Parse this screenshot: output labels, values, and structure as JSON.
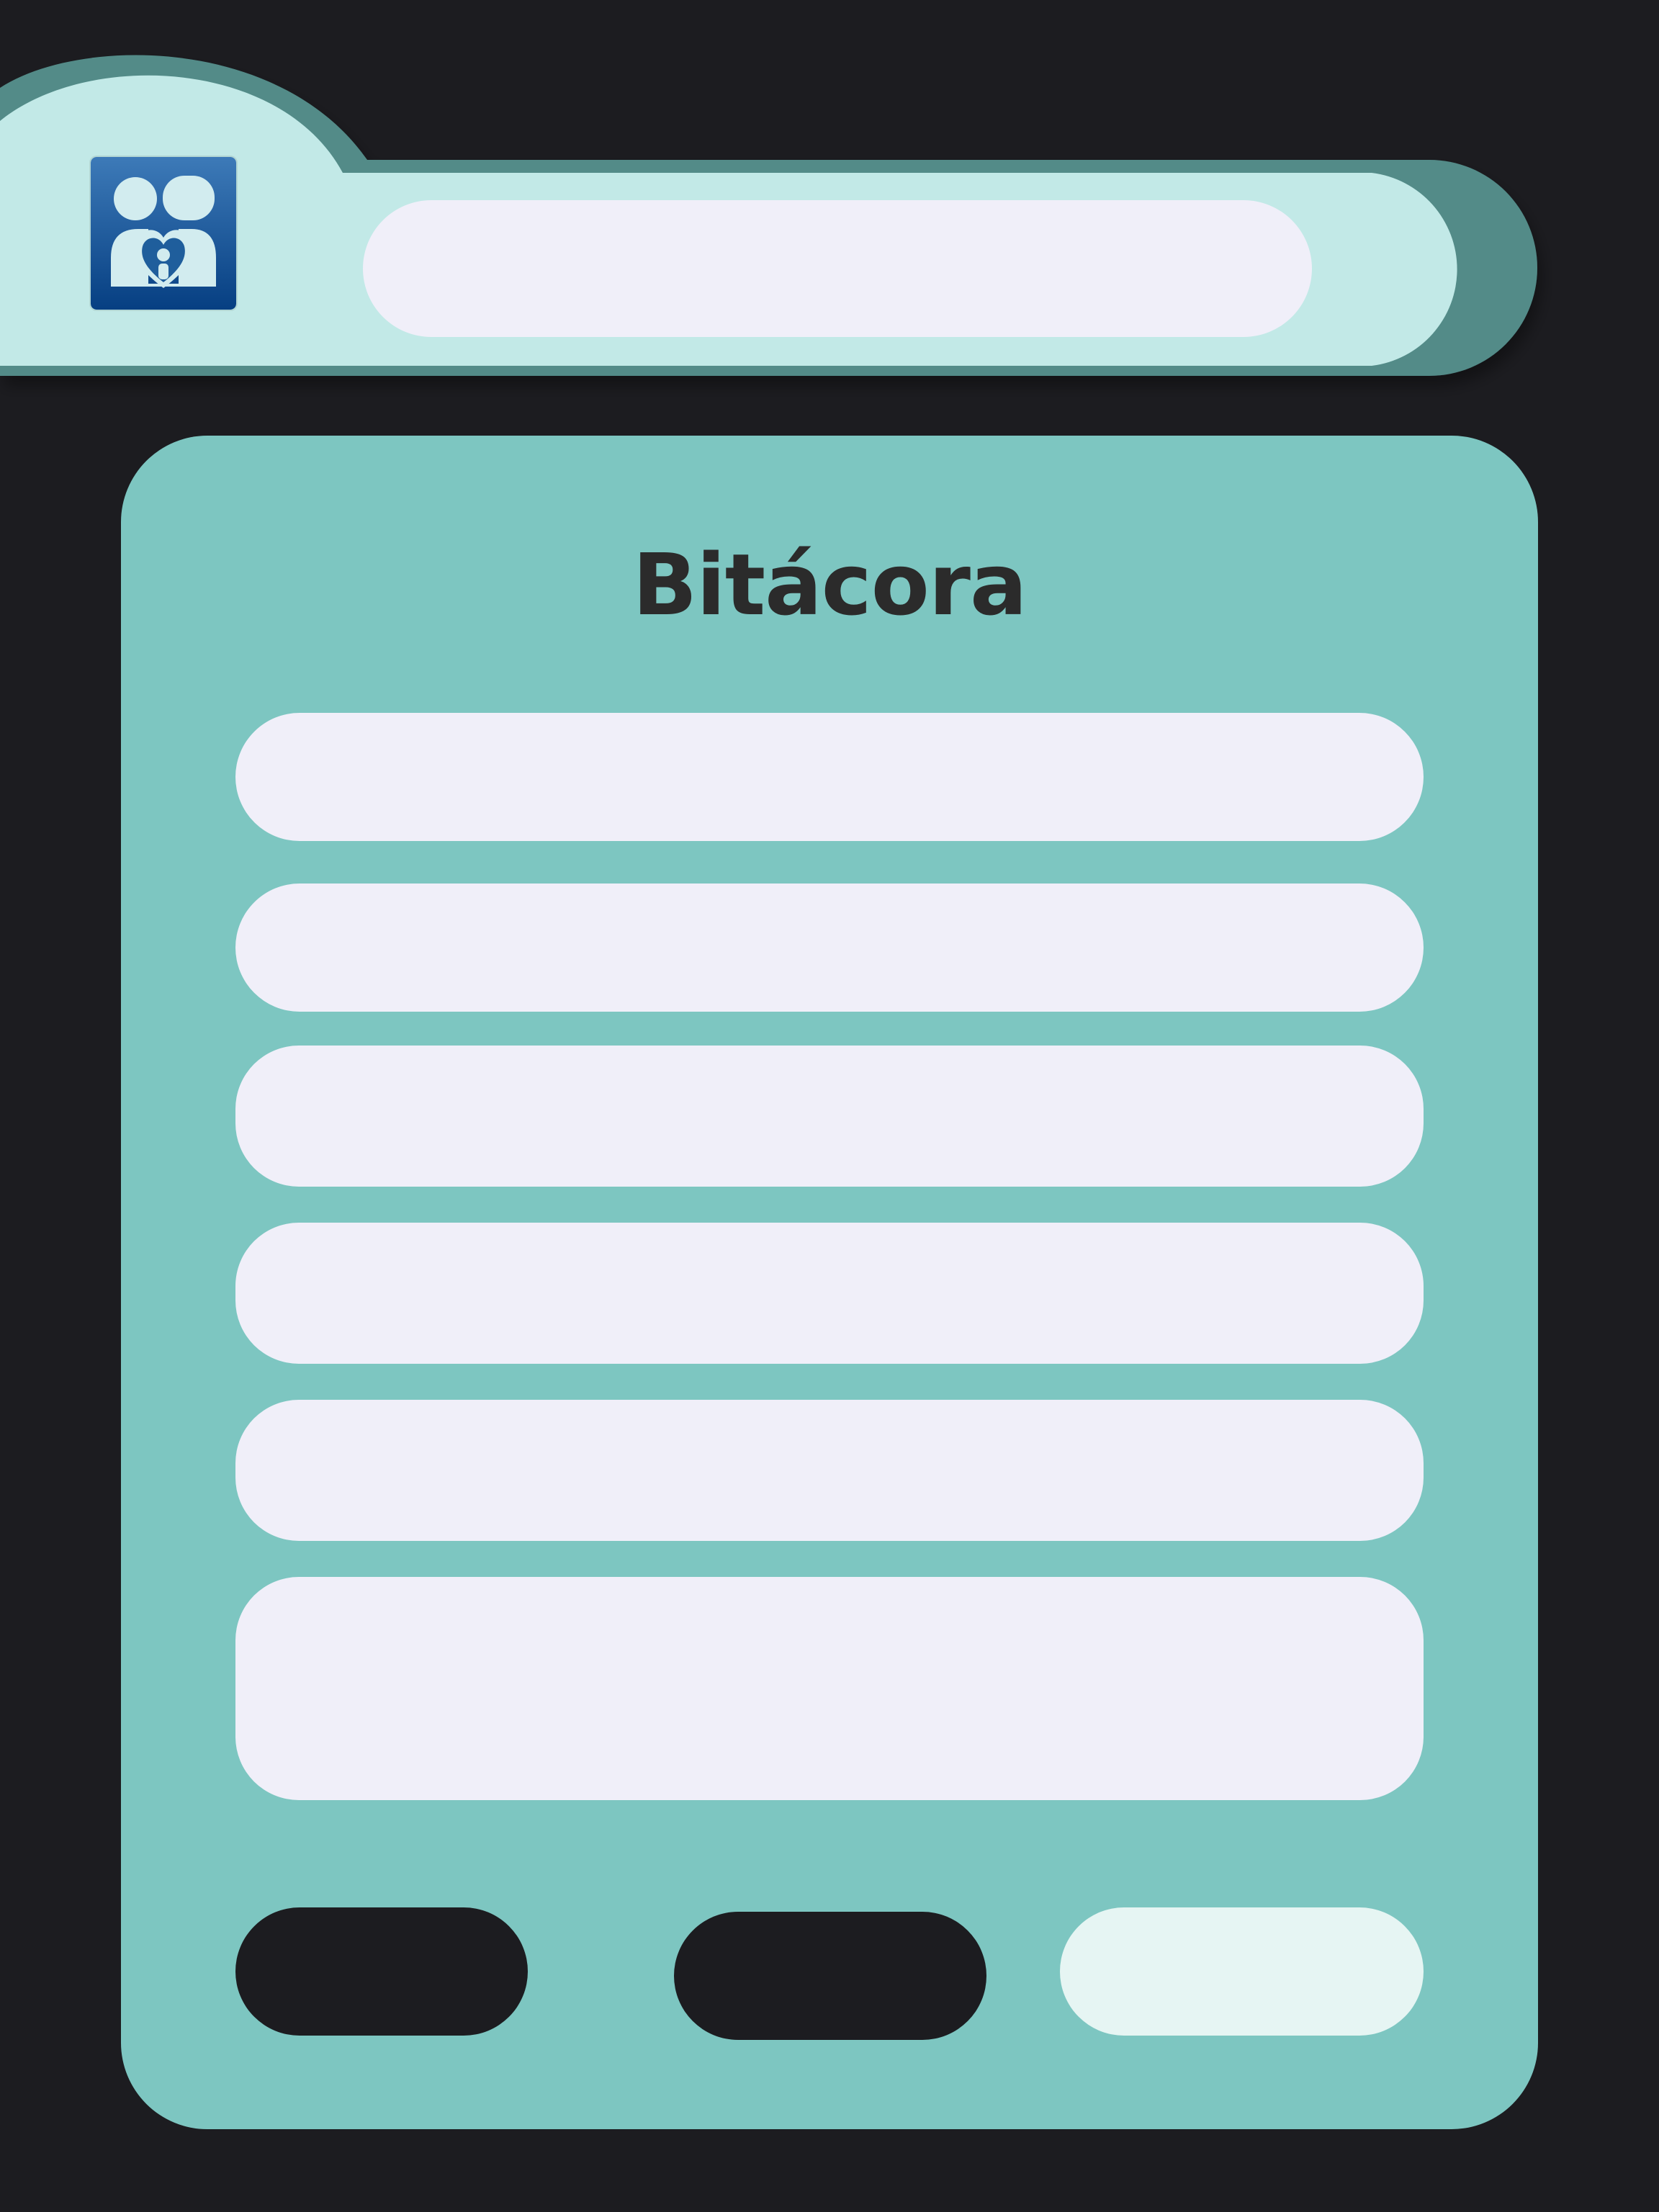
{
  "colors": {
    "background": "#1c1c20",
    "header_fill": "#c2e9e7",
    "header_border": "#538b88",
    "card": "#7dc6c1",
    "field": "#f0eff9",
    "button_dark": "#1c1c20",
    "button_light": "#e6f5f3",
    "logo_blue": "#1b5a9b"
  },
  "header": {
    "logo_icon": "family-logo-icon",
    "search": {
      "value": "",
      "placeholder": ""
    }
  },
  "card": {
    "title": "Bitácora",
    "fields": [
      {
        "value": "",
        "placeholder": ""
      },
      {
        "value": "",
        "placeholder": ""
      },
      {
        "value": "",
        "placeholder": ""
      },
      {
        "value": "",
        "placeholder": ""
      },
      {
        "value": "",
        "placeholder": ""
      },
      {
        "value": "",
        "placeholder": ""
      }
    ],
    "buttons": [
      {
        "label": ""
      },
      {
        "label": ""
      },
      {
        "label": ""
      }
    ]
  }
}
